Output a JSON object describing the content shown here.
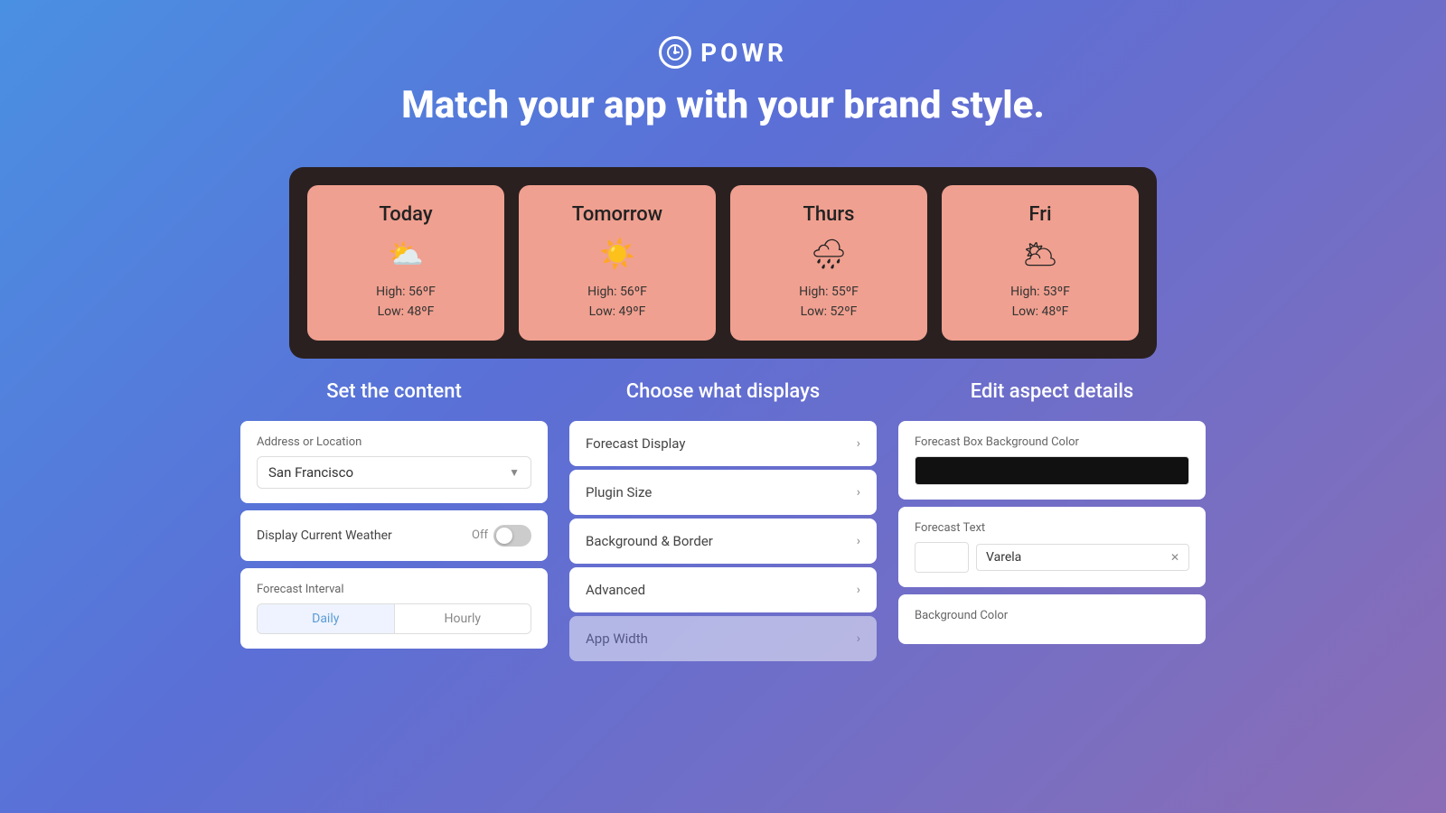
{
  "header": {
    "logo_text": "POWR",
    "tagline": "Match your app with your brand style."
  },
  "weather": {
    "cards": [
      {
        "day": "Today",
        "icon": "⛅",
        "high": "High: 56ºF",
        "low": "Low: 48ºF"
      },
      {
        "day": "Tomorrow",
        "icon": "☀️",
        "high": "High: 56ºF",
        "low": "Low: 49ºF"
      },
      {
        "day": "Thurs",
        "icon": "🌧",
        "high": "High: 55ºF",
        "low": "Low: 52ºF"
      },
      {
        "day": "Fri",
        "icon": "🌥",
        "high": "High: 53ºF",
        "low": "Low: 48ºF"
      }
    ]
  },
  "sections": {
    "left": {
      "title": "Set the content",
      "address_label": "Address or Location",
      "address_value": "San Francisco",
      "display_label": "Display Current Weather",
      "toggle_off": "Off",
      "interval_label": "Forecast Interval",
      "interval_daily": "Daily",
      "interval_hourly": "Hourly"
    },
    "middle": {
      "title": "Choose what displays",
      "items": [
        "Forecast Display",
        "Plugin Size",
        "Background & Border",
        "Advanced",
        "App Width"
      ]
    },
    "right": {
      "title": "Edit aspect details",
      "bg_color_label": "Forecast Box Background Color",
      "forecast_text_label": "Forecast Text",
      "font_name": "Varela",
      "bg_color2_label": "Background Color"
    }
  }
}
